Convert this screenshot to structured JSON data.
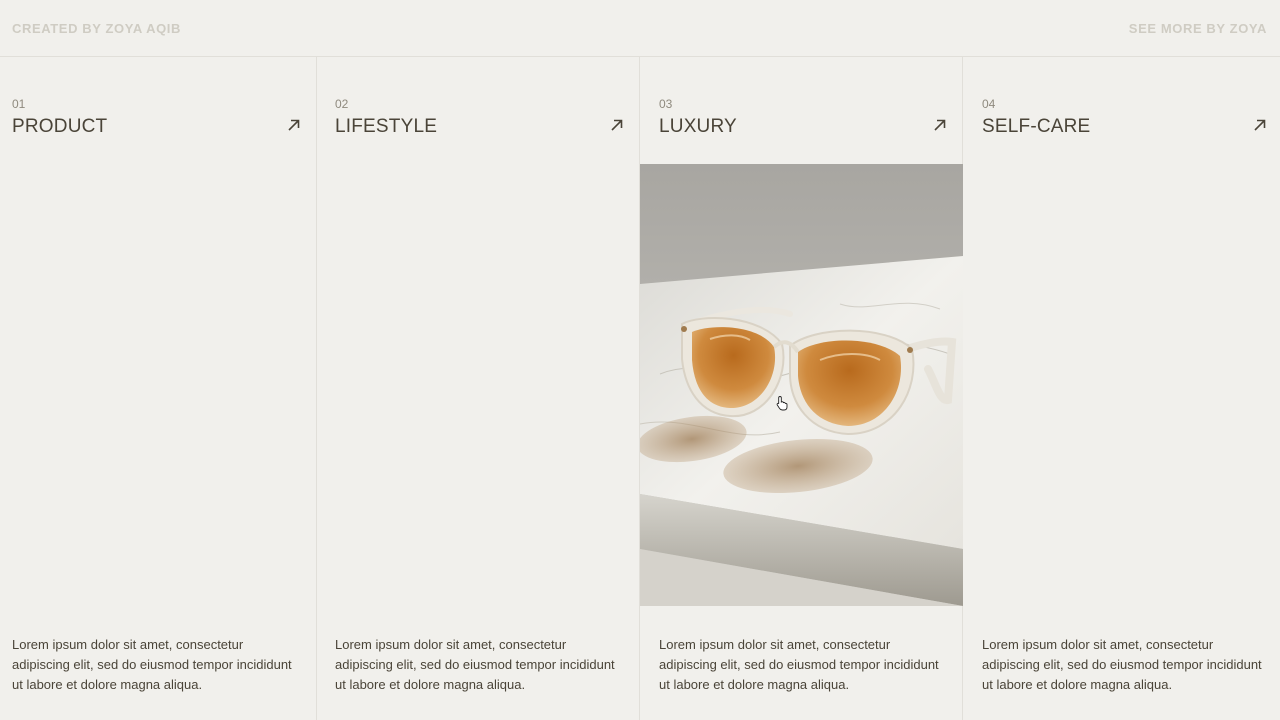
{
  "header": {
    "credit": "CREATED BY ZOYA AQIB",
    "see_more": "SEE MORE BY ZOYA"
  },
  "categories": [
    {
      "number": "01",
      "title": "PRODUCT",
      "description": "Lorem ipsum dolor sit amet, consectetur adipiscing elit, sed do eiusmod tempor incididunt ut labore et dolore magna aliqua."
    },
    {
      "number": "02",
      "title": "LIFESTYLE",
      "description": "Lorem ipsum dolor sit amet, consectetur adipiscing elit, sed do eiusmod tempor incididunt ut labore et dolore magna aliqua."
    },
    {
      "number": "03",
      "title": "LUXURY",
      "description": "Lorem ipsum dolor sit amet, consectetur adipiscing elit, sed do eiusmod tempor incididunt ut labore et dolore magna aliqua.",
      "image": "sunglasses-on-marble"
    },
    {
      "number": "04",
      "title": "SELF-CARE",
      "description": "Lorem ipsum dolor sit amet, consectetur adipiscing elit, sed do eiusmod tempor incididunt ut labore et dolore magna aliqua."
    }
  ],
  "icons": {
    "arrow": "arrow-up-right-icon",
    "cursor": "hand-pointer-icon"
  },
  "colors": {
    "background": "#f1f0ec",
    "text": "#4a4438",
    "muted": "#cfccc3",
    "divider": "#e1dfd9"
  }
}
